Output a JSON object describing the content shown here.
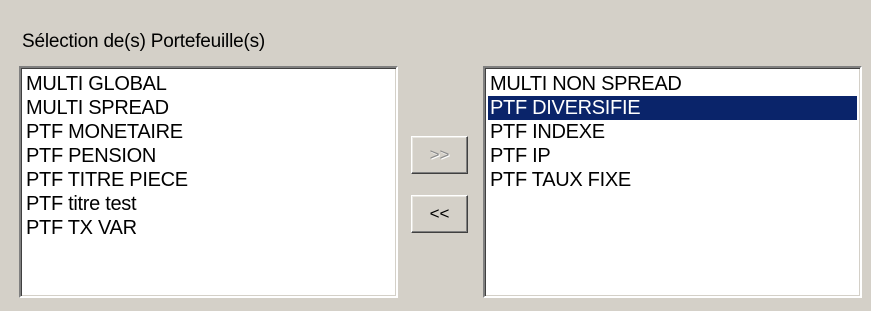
{
  "group": {
    "title": "Sélection de(s) Portefeuille(s)"
  },
  "available_list": {
    "items": [
      "MULTI GLOBAL",
      "MULTI SPREAD",
      "PTF MONETAIRE",
      "PTF PENSION",
      "PTF TITRE PIECE",
      "PTF titre test",
      "PTF TX VAR"
    ]
  },
  "selected_list": {
    "items": [
      "MULTI NON SPREAD",
      "PTF DIVERSIFIE",
      "PTF INDEXE",
      "PTF IP",
      "PTF TAUX FIXE"
    ],
    "highlighted": "PTF DIVERSIFIE"
  },
  "buttons": {
    "add_label": ">>",
    "add_enabled": false,
    "remove_label": "<<",
    "remove_enabled": true
  },
  "colors": {
    "dialog_background": "#d4d0c8",
    "selection_highlight": "#0a246a",
    "selection_text": "#ffffff",
    "disabled_text": "#8c8c8c"
  }
}
